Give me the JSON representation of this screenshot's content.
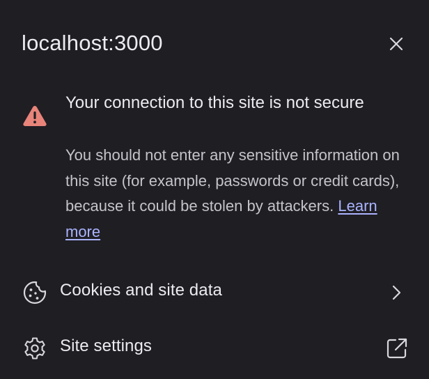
{
  "header": {
    "title": "localhost:3000"
  },
  "security": {
    "title": "Your connection to this site is not secure",
    "description": "You should not enter any sensitive information on this site (for example, passwords or credit cards), because it could be stolen by attackers.",
    "learn_more": "Learn more"
  },
  "rows": [
    {
      "label": "Cookies and site data",
      "icon": "cookie-icon",
      "trailing_icon": "chevron-right-icon"
    },
    {
      "label": "Site settings",
      "icon": "gear-icon",
      "trailing_icon": "external-link-icon"
    }
  ],
  "colors": {
    "background": "#1f1e23",
    "warning": "#e8847a",
    "link": "#aab4ff",
    "text": "#ececf0",
    "secondary_text": "#c4c4ca"
  }
}
